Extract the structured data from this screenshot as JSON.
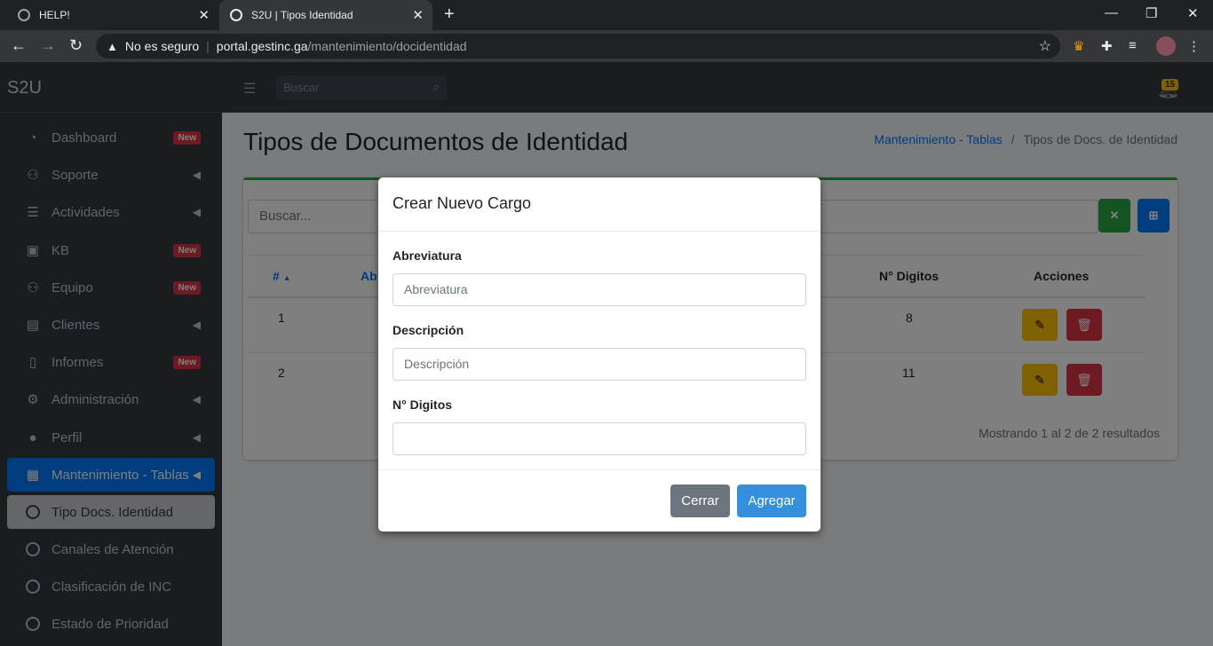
{
  "browser": {
    "tabs": [
      {
        "title": "HELP!"
      },
      {
        "title": "S2U | Tipos Identidad"
      }
    ],
    "security_label": "No es seguro",
    "url_domain": "portal.gestinc.ga",
    "url_path": "/mantenimiento/docidentidad"
  },
  "app": {
    "brand": "S2U",
    "search_placeholder": "Buscar",
    "notifications_count": "15"
  },
  "sidebar": {
    "items": [
      {
        "label": "Dashboard",
        "badge": "New"
      },
      {
        "label": "Soporte"
      },
      {
        "label": "Actividades"
      },
      {
        "label": "KB",
        "badge": "New"
      },
      {
        "label": "Equipo",
        "badge": "New"
      },
      {
        "label": "Clientes"
      },
      {
        "label": "Informes",
        "badge": "New"
      },
      {
        "label": "Administración"
      },
      {
        "label": "Perfil"
      },
      {
        "label": "Mantenimiento - Tablas"
      },
      {
        "label": "Tipo Docs. Identidad"
      },
      {
        "label": "Canales de Atención"
      },
      {
        "label": "Clasificación de INC"
      },
      {
        "label": "Estado de Prioridad"
      }
    ]
  },
  "page": {
    "title": "Tipos de Documentos de Identidad",
    "breadcrumb_parent": "Mantenimiento - Tablas",
    "breadcrumb_sep": "/",
    "breadcrumb_current": "Tipos de Docs. de Identidad",
    "search_placeholder": "Buscar...",
    "columns": {
      "num": "#",
      "abbr": "Ab",
      "digits": "N° Digitos",
      "actions": "Acciones"
    },
    "rows": [
      {
        "num": "1",
        "digits": "8"
      },
      {
        "num": "2",
        "digits": "11"
      }
    ],
    "showing": "Mostrando 1 al 2 de 2 resultados"
  },
  "modal": {
    "title": "Crear Nuevo Cargo",
    "abbr_label": "Abreviatura",
    "abbr_placeholder": "Abreviatura",
    "desc_label": "Descripción",
    "desc_placeholder": "Descripción",
    "digits_label": "N° Digitos",
    "digits_value": "",
    "close_label": "Cerrar",
    "add_label": "Agregar"
  },
  "colors": {
    "primary": "#007bff",
    "success": "#28a745",
    "danger": "#dc3545",
    "warning": "#ffc107",
    "secondary": "#6c757d"
  }
}
